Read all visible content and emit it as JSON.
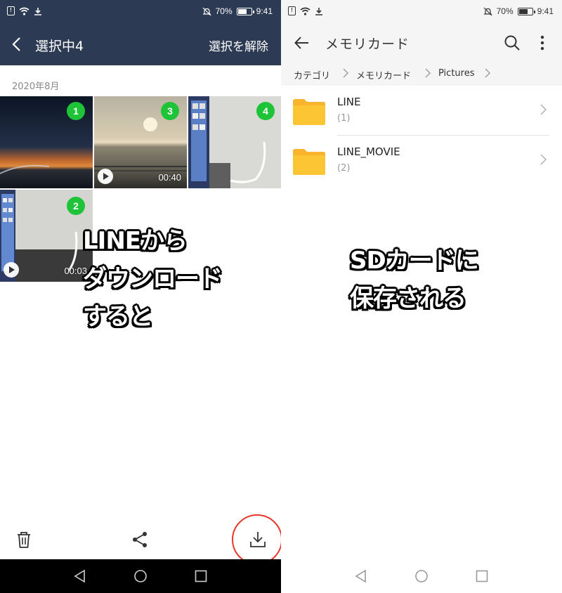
{
  "left": {
    "status": {
      "battery_text": "70%",
      "time": "9:41",
      "battery_level": 0.7
    },
    "header": {
      "title": "選択中4",
      "deselect_label": "選択を解除"
    },
    "date_label": "2020年8月",
    "thumbnails": [
      {
        "badge": "1",
        "duration": ""
      },
      {
        "badge": "3",
        "duration": "00:40"
      },
      {
        "badge": "4",
        "duration": ""
      },
      {
        "badge": "2",
        "duration": "00:03"
      }
    ],
    "caption_lines": [
      "LINEから",
      "ダウンロード",
      "すると"
    ],
    "toolbar": {
      "delete_icon": "trash-icon",
      "share_icon": "share-icon",
      "download_icon": "download-icon"
    },
    "highlight_color": "#e8382b"
  },
  "right": {
    "status": {
      "battery_text": "70%",
      "time": "9:41",
      "battery_level": 0.7
    },
    "header": {
      "title": "メモリカード"
    },
    "breadcrumb": [
      "カテゴリ",
      "メモリカード",
      "Pictures"
    ],
    "folders": [
      {
        "name": "LINE",
        "count": "(1)"
      },
      {
        "name": "LINE_MOVIE",
        "count": "(2)"
      }
    ],
    "caption_lines": [
      "SDカードに",
      "保存される"
    ]
  },
  "colors": {
    "line_header": "#2d3a54",
    "badge_green": "#1ec337",
    "folder_yellow": "#fbc02d"
  }
}
